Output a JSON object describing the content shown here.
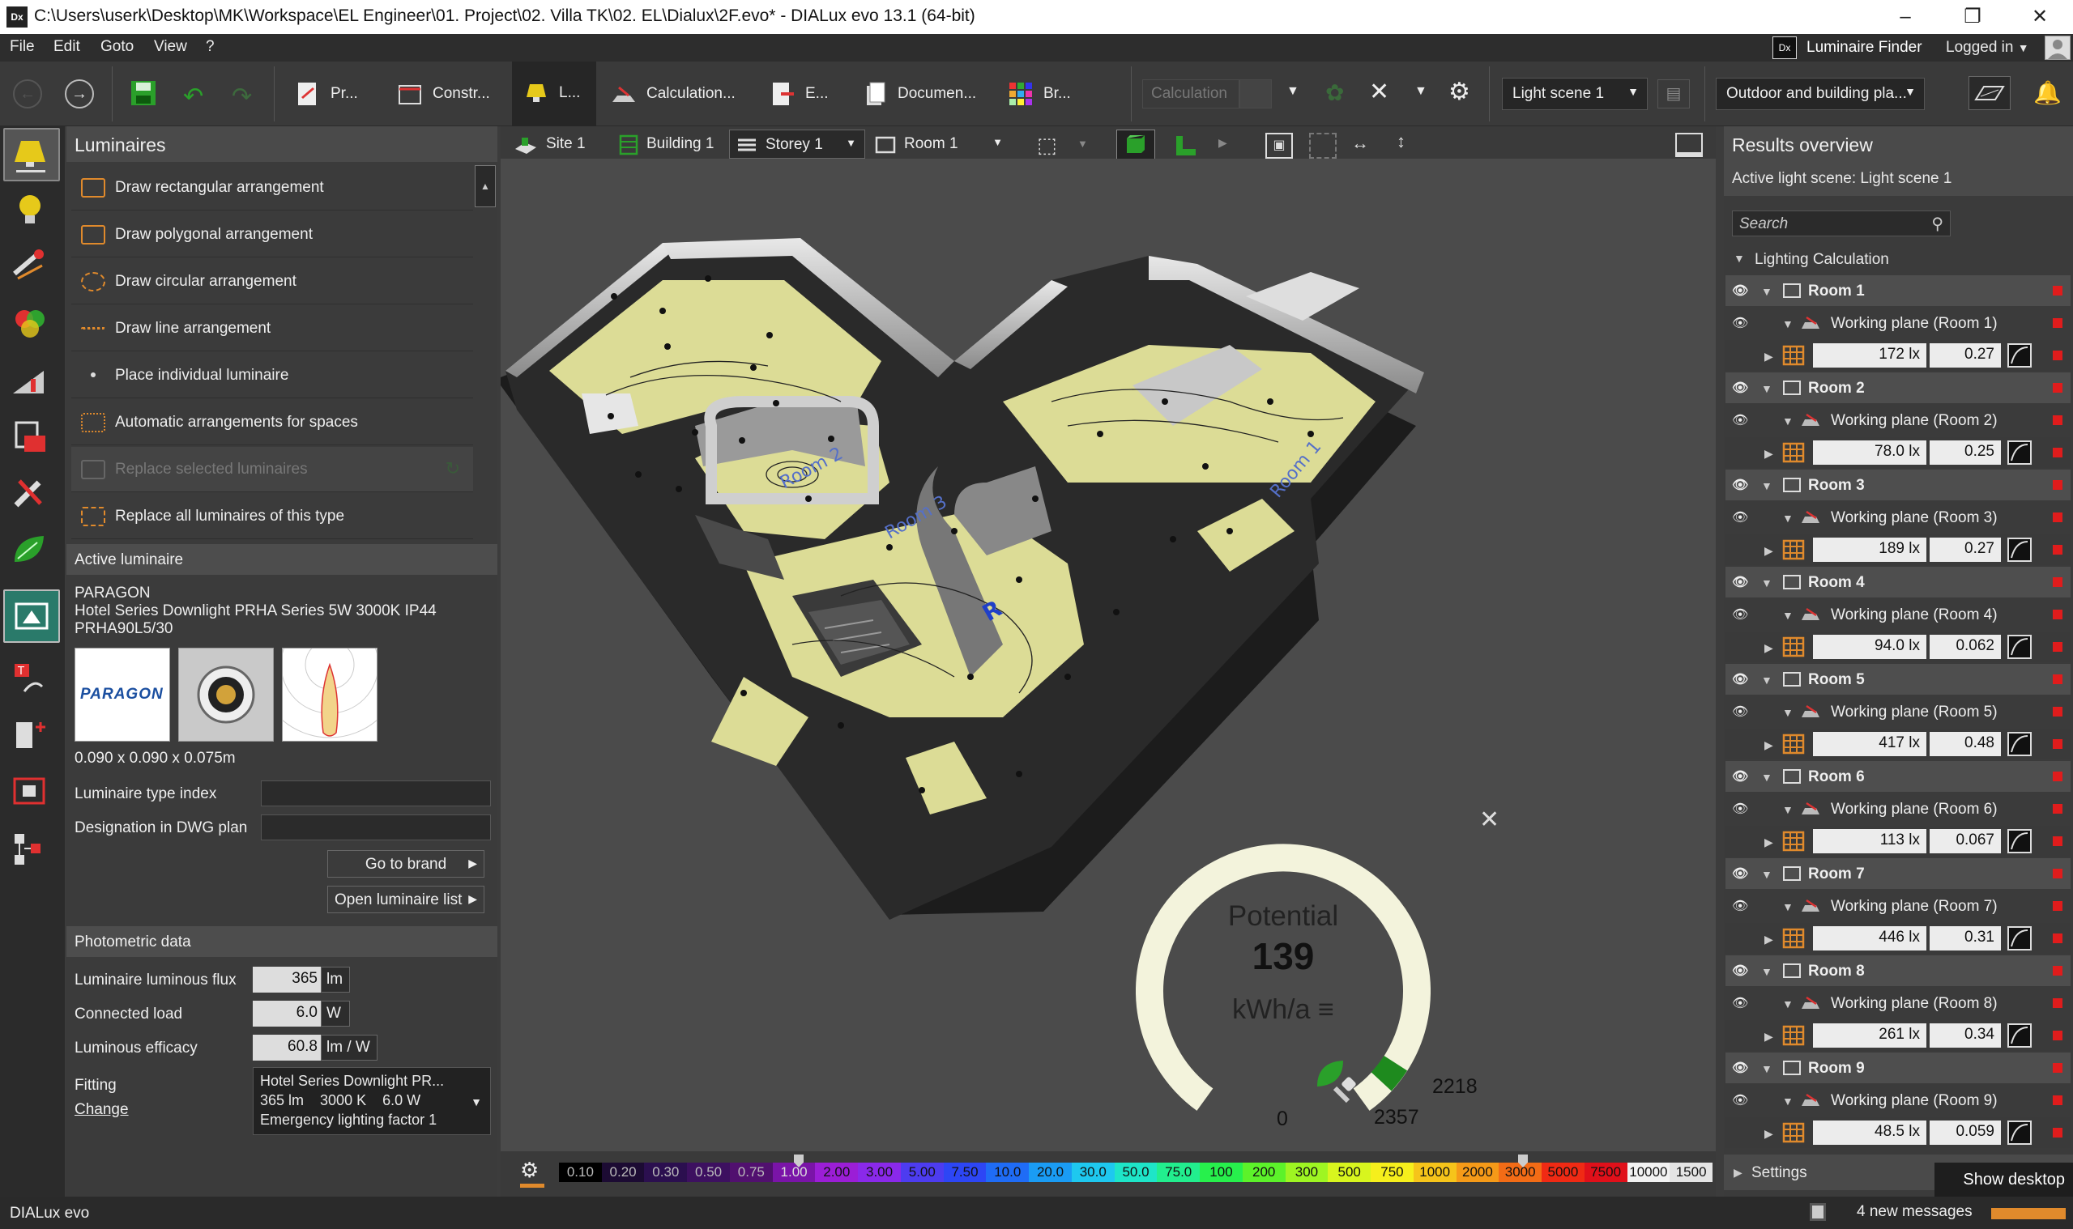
{
  "titlebar": {
    "icon_text": "Dx",
    "title": "C:\\Users\\userk\\Desktop\\MK\\Workspace\\EL Engineer\\01. Project\\02. Villa TK\\02. EL\\Dialux\\2F.evo* - DIALux evo 13.1  (64-bit)"
  },
  "menu": {
    "items": [
      "File",
      "Edit",
      "Goto",
      "View",
      "?"
    ],
    "luminaire_finder": "Luminaire Finder",
    "logged_in": "Logged in"
  },
  "toolbar": {
    "modes": [
      {
        "label": "Pr..."
      },
      {
        "label": "Constr..."
      },
      {
        "label": "L..."
      },
      {
        "label": "Calculation..."
      },
      {
        "label": "E..."
      },
      {
        "label": "Documen..."
      },
      {
        "label": "Br..."
      }
    ],
    "calculation_label": "Calculation",
    "light_scene": "Light scene 1",
    "outdoor_building": "Outdoor and building pla..."
  },
  "left_panel": {
    "title": "Luminaires",
    "items": [
      {
        "label": "Draw rectangular arrangement",
        "disabled": false
      },
      {
        "label": "Draw polygonal arrangement",
        "disabled": false
      },
      {
        "label": "Draw circular arrangement",
        "disabled": false
      },
      {
        "label": "Draw line arrangement",
        "disabled": false
      },
      {
        "label": "Place individual luminaire",
        "disabled": false
      },
      {
        "label": "Automatic arrangements for spaces",
        "disabled": false
      },
      {
        "label": "Replace selected luminaires",
        "disabled": true
      },
      {
        "label": "Replace all luminaires of this type",
        "disabled": false
      }
    ],
    "active_luminaire": {
      "heading": "Active luminaire",
      "brand": "PARAGON",
      "name": "Hotel Series Downlight PRHA Series 5W 3000K IP44",
      "code": "PRHA90L5/30",
      "logo_text": "PARAGON",
      "dimensions": "0.090 x 0.090 x 0.075m",
      "type_index_label": "Luminaire type index",
      "designation_label": "Designation in DWG plan",
      "go_to_brand": "Go to brand",
      "open_list": "Open luminaire list"
    },
    "photometric": {
      "heading": "Photometric data",
      "flux_label": "Luminaire luminous flux",
      "flux_value": "365",
      "flux_unit": "lm",
      "load_label": "Connected load",
      "load_value": "6.0",
      "load_unit": "W",
      "efficacy_label": "Luminous efficacy",
      "efficacy_value": "60.8",
      "efficacy_unit": "lm / W",
      "fitting_label": "Fitting",
      "change_link": "Change",
      "fitting_line1": "Hotel Series Downlight PR...",
      "fitting_line2": "365 lm    3000 K    6.0 W",
      "fitting_line3": "Emergency lighting factor  1"
    }
  },
  "viewport": {
    "breadcrumbs": [
      "Site 1",
      "Building 1",
      "Storey 1",
      "Room 1"
    ],
    "gauge": {
      "title": "Potential",
      "value": "139",
      "unit": "kWh/a",
      "min": "0",
      "mark1": "2357",
      "mark2": "2218",
      "fill_fraction": 0.94
    },
    "room_labels": [
      "Room 1",
      "Room 2",
      "Room 3",
      "R"
    ],
    "scale": [
      {
        "v": "0.10",
        "c": "#000000",
        "t": "#bbb"
      },
      {
        "v": "0.20",
        "c": "#1c0b33",
        "t": "#bbb"
      },
      {
        "v": "0.30",
        "c": "#2b0f4f",
        "t": "#bbb"
      },
      {
        "v": "0.50",
        "c": "#3d1060",
        "t": "#bbb"
      },
      {
        "v": "0.75",
        "c": "#51106f",
        "t": "#bbb"
      },
      {
        "v": "1.00",
        "c": "#7a14a8",
        "t": "#ddd"
      },
      {
        "v": "2.00",
        "c": "#9b1ed6",
        "t": "#111"
      },
      {
        "v": "3.00",
        "c": "#8a29ea",
        "t": "#111"
      },
      {
        "v": "5.00",
        "c": "#4d3cf0",
        "t": "#111"
      },
      {
        "v": "7.50",
        "c": "#2d46f5",
        "t": "#111"
      },
      {
        "v": "10.0",
        "c": "#1f6cf6",
        "t": "#111"
      },
      {
        "v": "20.0",
        "c": "#1a9cf4",
        "t": "#111"
      },
      {
        "v": "30.0",
        "c": "#1ec8ef",
        "t": "#111"
      },
      {
        "v": "50.0",
        "c": "#1ee5c8",
        "t": "#111"
      },
      {
        "v": "75.0",
        "c": "#22ee8e",
        "t": "#111"
      },
      {
        "v": "100",
        "c": "#27f04c",
        "t": "#111"
      },
      {
        "v": "200",
        "c": "#5cf22a",
        "t": "#111"
      },
      {
        "v": "300",
        "c": "#9ef522",
        "t": "#111"
      },
      {
        "v": "500",
        "c": "#d8f51e",
        "t": "#111"
      },
      {
        "v": "750",
        "c": "#f6ef1c",
        "t": "#111"
      },
      {
        "v": "1000",
        "c": "#f6c41a",
        "t": "#111"
      },
      {
        "v": "2000",
        "c": "#f59a18",
        "t": "#111"
      },
      {
        "v": "3000",
        "c": "#f36c16",
        "t": "#111"
      },
      {
        "v": "5000",
        "c": "#f02a14",
        "t": "#111"
      },
      {
        "v": "7500",
        "c": "#e0101a",
        "t": "#111"
      },
      {
        "v": "10000",
        "c": "#f2f2f2",
        "t": "#111"
      },
      {
        "v": "1500",
        "c": "#e4e4e4",
        "t": "#111"
      }
    ]
  },
  "right_panel": {
    "title": "Results overview",
    "active_scene": "Active light scene: Light scene 1",
    "search_placeholder": "Search",
    "group_label": "Lighting Calculation",
    "rooms": [
      {
        "name": "Room 1",
        "plane": "Working plane (Room 1)",
        "lux": "172 lx",
        "ratio": "0.27"
      },
      {
        "name": "Room 2",
        "plane": "Working plane (Room 2)",
        "lux": "78.0 lx",
        "ratio": "0.25"
      },
      {
        "name": "Room 3",
        "plane": "Working plane (Room 3)",
        "lux": "189 lx",
        "ratio": "0.27"
      },
      {
        "name": "Room 4",
        "plane": "Working plane (Room 4)",
        "lux": "94.0 lx",
        "ratio": "0.062"
      },
      {
        "name": "Room 5",
        "plane": "Working plane (Room 5)",
        "lux": "417 lx",
        "ratio": "0.48"
      },
      {
        "name": "Room 6",
        "plane": "Working plane (Room 6)",
        "lux": "113 lx",
        "ratio": "0.067"
      },
      {
        "name": "Room 7",
        "plane": "Working plane (Room 7)",
        "lux": "446 lx",
        "ratio": "0.31"
      },
      {
        "name": "Room 8",
        "plane": "Working plane (Room 8)",
        "lux": "261 lx",
        "ratio": "0.34"
      },
      {
        "name": "Room 9",
        "plane": "Working plane (Room 9)",
        "lux": "48.5 lx",
        "ratio": "0.059"
      }
    ],
    "settings_label": "Settings",
    "show_desktop": "Show desktop"
  },
  "statusbar": {
    "brand": "DIALux evo",
    "messages": "4 new messages"
  },
  "colors": {
    "accent_orange": "#e08a2c",
    "status_red": "#e01c1c",
    "gauge_green": "#1e8a1e",
    "floor_yellow": "#dede9a"
  }
}
